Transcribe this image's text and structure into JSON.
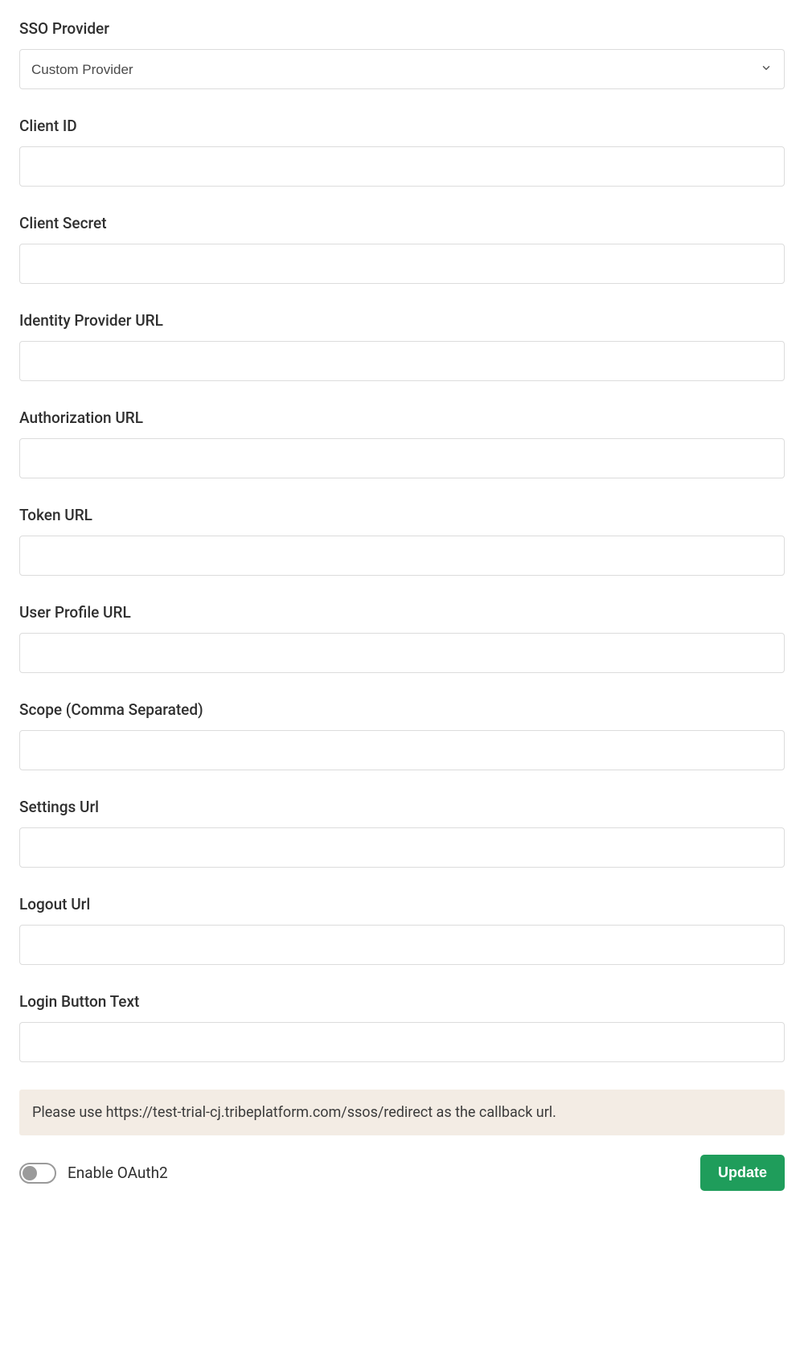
{
  "form": {
    "sso_provider": {
      "label": "SSO Provider",
      "selected": "Custom Provider"
    },
    "client_id": {
      "label": "Client ID",
      "value": ""
    },
    "client_secret": {
      "label": "Client Secret",
      "value": ""
    },
    "idp_url": {
      "label": "Identity Provider URL",
      "value": ""
    },
    "auth_url": {
      "label": "Authorization URL",
      "value": ""
    },
    "token_url": {
      "label": "Token URL",
      "value": ""
    },
    "user_profile_url": {
      "label": "User Profile URL",
      "value": ""
    },
    "scope": {
      "label": "Scope (Comma Separated)",
      "value": ""
    },
    "settings_url": {
      "label": "Settings Url",
      "value": ""
    },
    "logout_url": {
      "label": "Logout Url",
      "value": ""
    },
    "login_button_text": {
      "label": "Login Button Text",
      "value": ""
    }
  },
  "callback_note": "Please use https://test-trial-cj.tribeplatform.com/ssos/redirect as the callback url.",
  "footer": {
    "toggle_label": "Enable OAuth2",
    "toggle_on": false,
    "update_button": "Update"
  }
}
